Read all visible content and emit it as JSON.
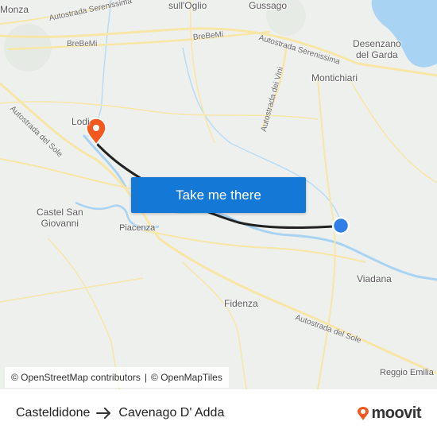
{
  "map": {
    "places": [
      {
        "id": "monza",
        "text": "Monza"
      },
      {
        "id": "sull-oglio",
        "text": "sull'Oglio"
      },
      {
        "id": "gussago",
        "text": "Gussago"
      },
      {
        "id": "desenzano",
        "text": "Desenzano\ndel Garda"
      },
      {
        "id": "montichiari",
        "text": "Montichiari"
      },
      {
        "id": "lodi",
        "text": "Lodi"
      },
      {
        "id": "castel-san-giovanni",
        "text": "Castel San\nGiovanni"
      },
      {
        "id": "piacenza",
        "text": "Piacenza"
      },
      {
        "id": "viadana",
        "text": "Viadana"
      },
      {
        "id": "fidenza",
        "text": "Fidenza"
      },
      {
        "id": "reggio-emilia",
        "text": "Reggio Emilia"
      }
    ],
    "road_labels": [
      {
        "id": "autostrada-serenissima-top",
        "text": "Autostrada Serenissima"
      },
      {
        "id": "brebemi-left",
        "text": "BreBeMi"
      },
      {
        "id": "brebemi-right",
        "text": "BreBeMi"
      },
      {
        "id": "autostrada-serenissima",
        "text": "Autostrada Serenissima"
      },
      {
        "id": "autostrada-dei-vini",
        "text": "Autostrada dei Vini"
      },
      {
        "id": "autostrada-del-sole-left",
        "text": "Autostrada del Sole"
      },
      {
        "id": "autostrada-del-sole-right",
        "text": "Autostrada del Sole"
      }
    ],
    "cta_label": "Take me there",
    "attribution": {
      "osm": "© OpenStreetMap contributors",
      "separator": "|",
      "tiles": "© OpenMapTiles"
    },
    "colors": {
      "route": "#222222",
      "destination_pin": "#f3581e",
      "origin_dot": "#2f7fe6",
      "water": "#a9d3f3",
      "road": "#f7e6a6",
      "cta_background": "#1479d6"
    }
  },
  "footer": {
    "from": "Casteldidone",
    "to": "Cavenago D' Adda",
    "brand": "moovit"
  }
}
